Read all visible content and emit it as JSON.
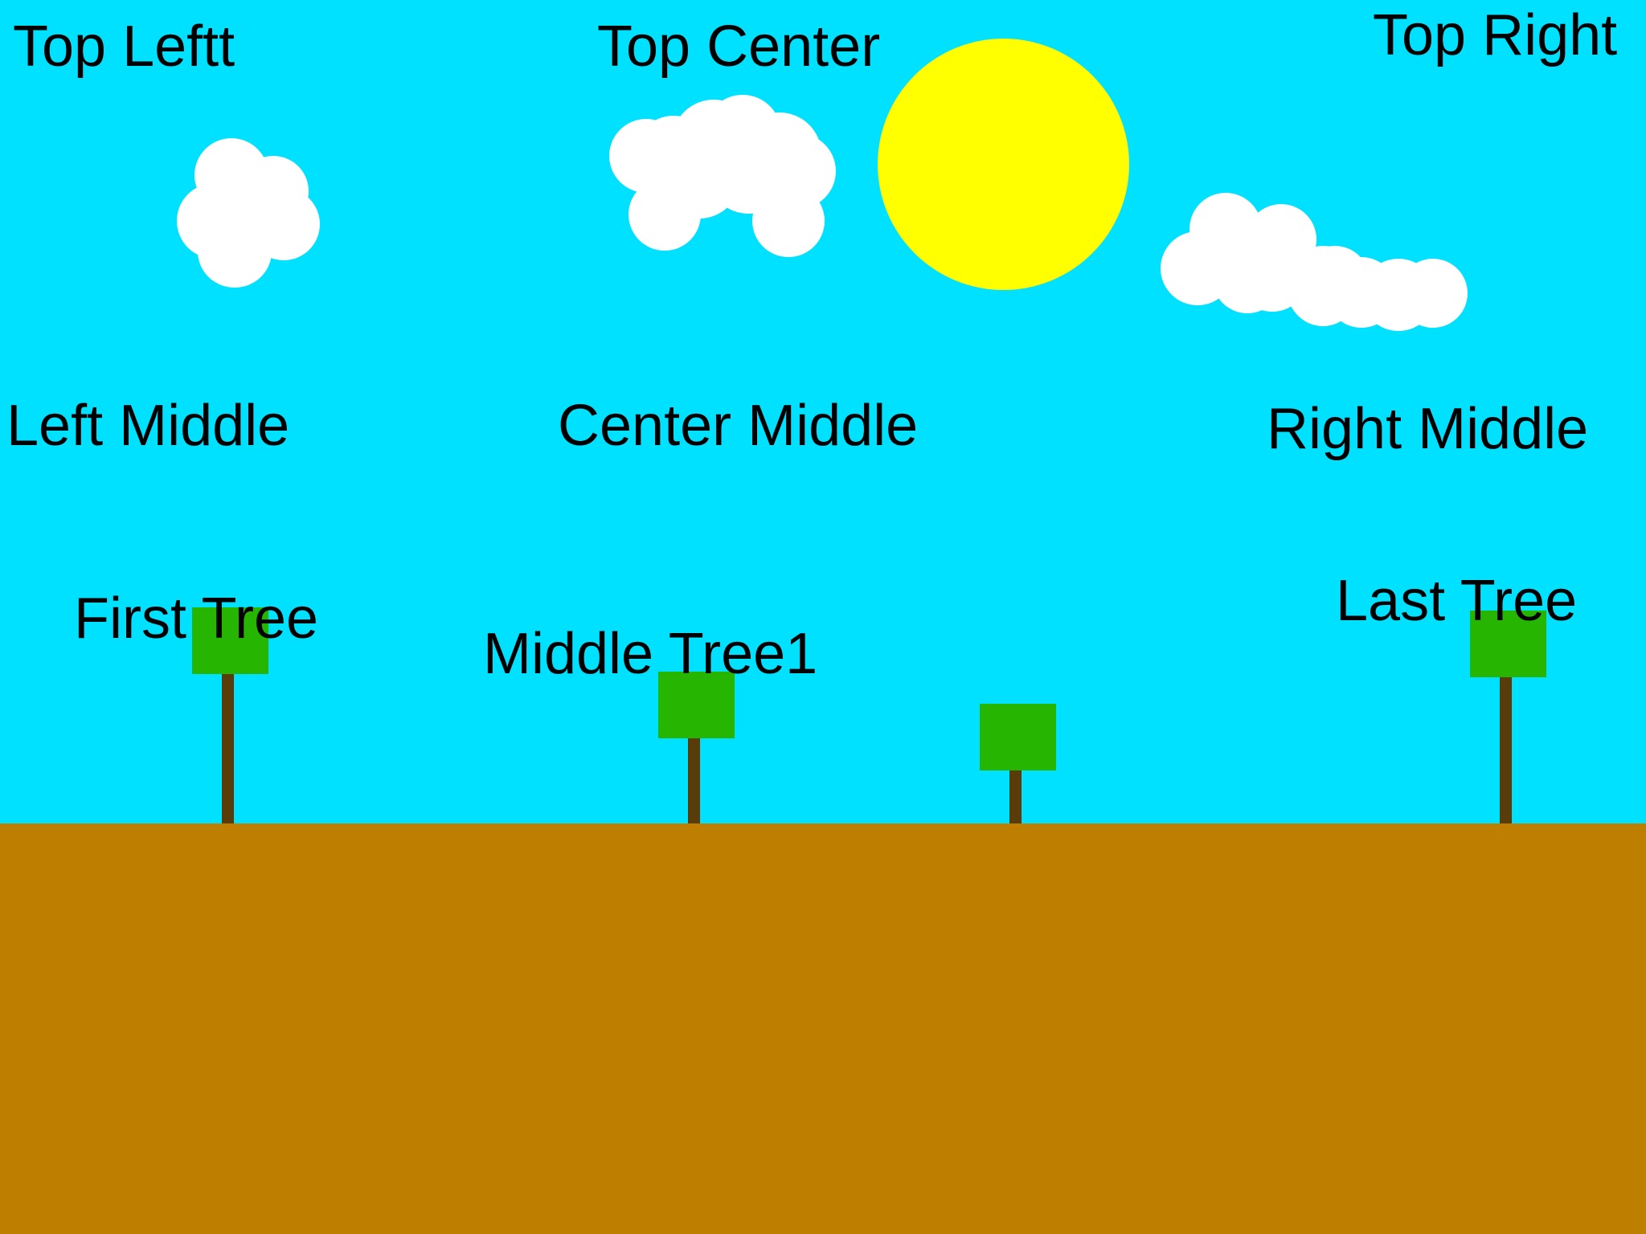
{
  "colors": {
    "sky": "#00e0ff",
    "ground": "#be7f00",
    "sun": "#ffff00",
    "cloud": "#ffffff",
    "canopy": "#26b500",
    "trunk": "#5a3c0a",
    "text": "#000000"
  },
  "labels": {
    "top_left": "Top Leftt",
    "top_center": "Top Center",
    "top_right": "Top Right",
    "left_middle": "Left Middle",
    "center_middle": "Center Middle",
    "right_middle": "Right Middle",
    "first_tree": "First Tree",
    "middle_tree1": "Middle Tree1",
    "last_tree": "Last Tree"
  }
}
